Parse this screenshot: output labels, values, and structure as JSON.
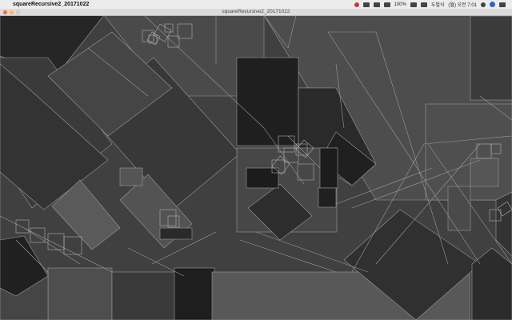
{
  "menubar": {
    "app_name": "squareRecursive2_20171022",
    "battery": "100%",
    "keyboard_lang": "두벌식",
    "clock": "(월) 오전 7:01",
    "icons": [
      "apple-icon",
      "record-icon",
      "dropbox-icon",
      "bluetooth-icon",
      "wifi-icon",
      "battery-icon",
      "flag-icon",
      "search-icon",
      "siri-icon",
      "notification-icon"
    ]
  },
  "window": {
    "title": "squareRecursive2_20171022",
    "colors": {
      "close": "#fe5f57",
      "minimize": "#febc2e",
      "maximize": "#d0d0d0"
    }
  },
  "canvas": {
    "description_colors": [
      "#1e1e1e",
      "#2e2e2e",
      "#3a3a3a",
      "#4a4a4a",
      "#575757",
      "#666666"
    ],
    "stroke": "#9a9a9a"
  }
}
